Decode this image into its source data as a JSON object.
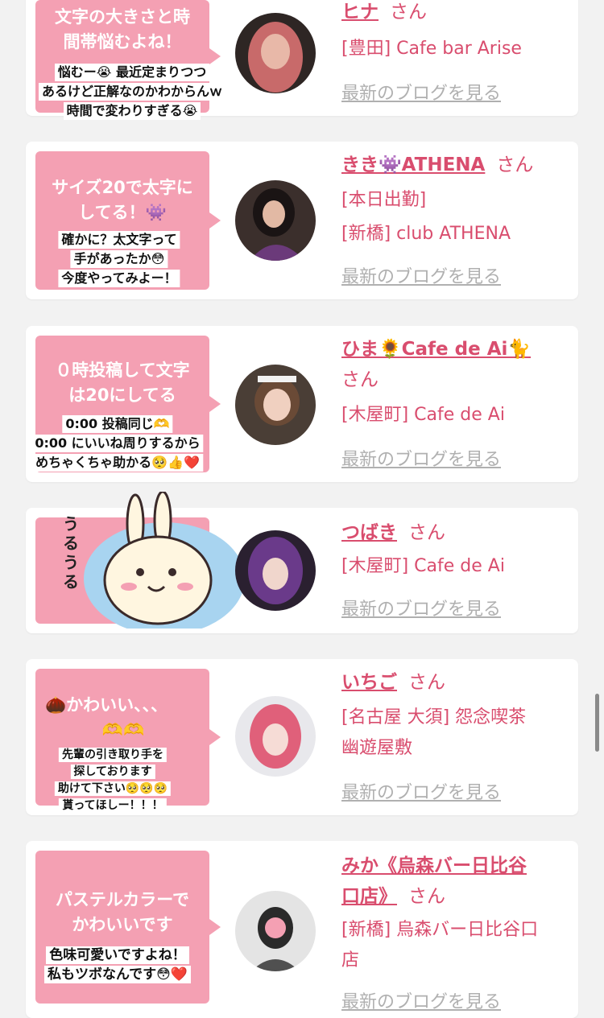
{
  "posts": [
    {
      "bubble_title": [
        "文字の大きさと時",
        "間帯悩むよね！"
      ],
      "stamp_lines": [
        "悩むー😭 最近定まりつつ",
        "あるけど正解なのかわからんｗ",
        "時間で変わりすぎる😭"
      ],
      "name": "ヒナ",
      "san": "さん",
      "shops": [
        "[豊田] Cafe bar Arise"
      ],
      "blog_link": "最新のブログを見る",
      "avatar_colors": [
        "#7a3b3a",
        "#c86a6a"
      ]
    },
    {
      "bubble_title": [
        "サイズ20で太字に",
        "してる！👾"
      ],
      "stamp_lines": [
        "確かに？太文字って",
        "手があったか😳",
        "今度やってみよー！"
      ],
      "name": "きき👾ATHENA",
      "san": "さん",
      "shops": [
        "[本日出勤]",
        "[新橋] club ATHENA"
      ],
      "blog_link": "最新のブログを見る",
      "avatar_colors": [
        "#3b2a3a",
        "#6b3a7a"
      ]
    },
    {
      "bubble_title": [
        "０時投稿して文字",
        "は20にしてる"
      ],
      "stamp_lines": [
        "0:00 投稿同じ🫶",
        "0:00 にいいね周りするから",
        "めちゃくちゃ助かる🥺👍❤️"
      ],
      "name": "ひま🌻Cafe de Ai🐈",
      "san": "さん",
      "shops": [
        "[木屋町] Cafe de Ai"
      ],
      "blog_link": "最新のブログを見る",
      "avatar_colors": [
        "#5a4a3a",
        "#d8c0a8"
      ]
    },
    {
      "bubble_title": [],
      "stamp_lines": [],
      "sticker_text": "うるうる",
      "name": "つばき",
      "san": "さん",
      "shops": [
        "[木屋町] Cafe de Ai"
      ],
      "blog_link": "最新のブログを見る",
      "avatar_colors": [
        "#3a2a5a",
        "#8a5ab0"
      ]
    },
    {
      "bubble_title": [
        "🌰かわいい、、、",
        "🫶🫶"
      ],
      "stamp_lines": [
        "先輩の引き取り手を",
        "探しております",
        "助けて下さい🥺🥺🥺",
        "貰ってほしー！！！"
      ],
      "name": "いちご",
      "san": "さん",
      "shops": [
        "[名古屋 大須] 怨念喫茶",
        "幽遊屋敷"
      ],
      "blog_link": "最新のブログを見る",
      "avatar_colors": [
        "#e0607a",
        "#f0c8d4"
      ]
    },
    {
      "bubble_title": [
        "パステルカラーで",
        "かわいいです"
      ],
      "stamp_lines": [
        "色味可愛いですよね！",
        "私もツボなんです😳❤️"
      ],
      "name": "みか《烏森バー日比谷",
      "name2": "口店》",
      "san": "さん",
      "shops": [
        "[新橋] 烏森バー日比谷口",
        "店"
      ],
      "blog_link": "最新のブログを見る",
      "avatar_colors": [
        "#dcdcdc",
        "#505050"
      ]
    }
  ],
  "accent_color": "#d94d6e",
  "bubble_color": "#f4a0b3"
}
